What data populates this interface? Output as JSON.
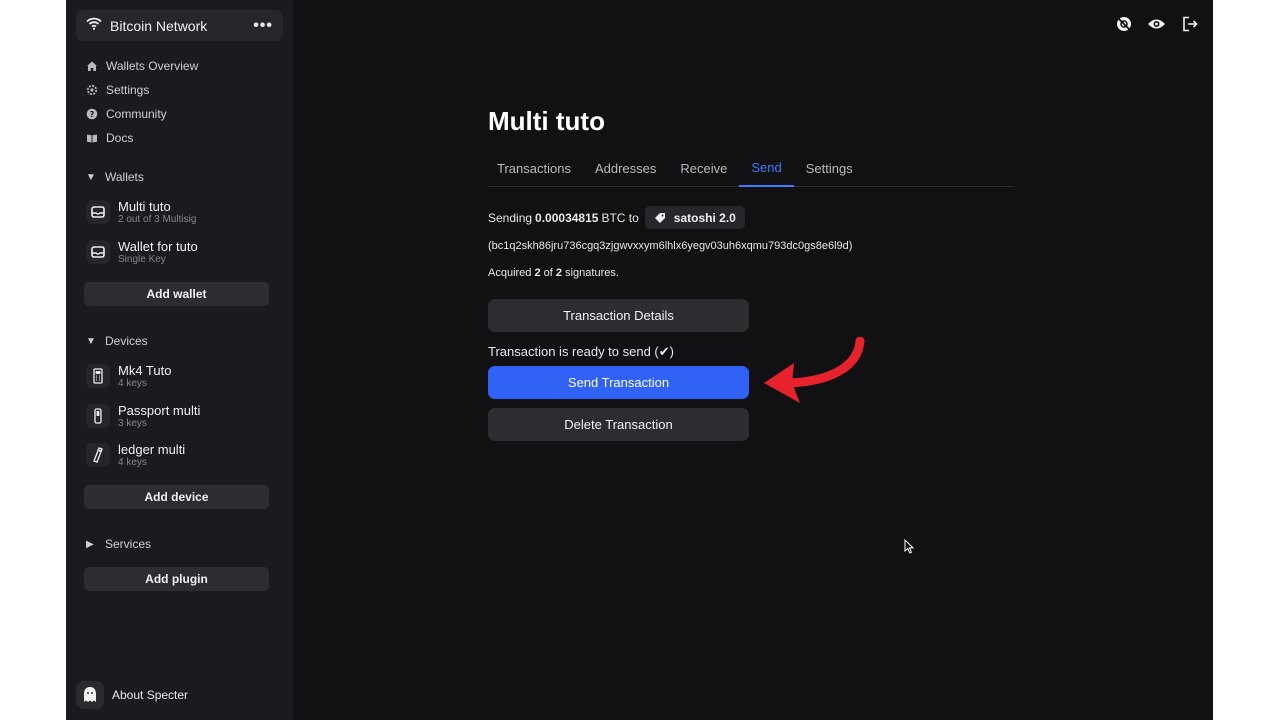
{
  "sidebar": {
    "network_label": "Bitcoin Network",
    "nav": [
      {
        "label": "Wallets Overview",
        "icon": "home-icon"
      },
      {
        "label": "Settings",
        "icon": "gear-icon"
      },
      {
        "label": "Community",
        "icon": "help-icon"
      },
      {
        "label": "Docs",
        "icon": "book-icon"
      }
    ],
    "wallets_header": "Wallets",
    "wallets": [
      {
        "name": "Multi tuto",
        "sub": "2 out of 3 Multisig"
      },
      {
        "name": "Wallet for tuto",
        "sub": "Single Key"
      }
    ],
    "add_wallet": "Add wallet",
    "devices_header": "Devices",
    "devices": [
      {
        "name": "Mk4 Tuto",
        "sub": "4 keys"
      },
      {
        "name": "Passport multi",
        "sub": "3 keys"
      },
      {
        "name": "ledger multi",
        "sub": "4 keys"
      }
    ],
    "add_device": "Add device",
    "services_header": "Services",
    "add_plugin": "Add plugin",
    "about": "About Specter"
  },
  "main": {
    "title": "Multi tuto",
    "tabs": [
      "Transactions",
      "Addresses",
      "Receive",
      "Send",
      "Settings"
    ],
    "active_tab": "Send",
    "sending_prefix": "Sending",
    "amount": "0.00034815",
    "amount_unit": "BTC to",
    "recipient_label": "satoshi 2.0",
    "address": "(bc1q2skh86jru736cgq3zjgwvxxym6lhlx6yegv03uh6xqmu793dc0gs8e6l9d)",
    "acquired_prefix": "Acquired",
    "acquired": "2",
    "of_text": "of",
    "required": "2",
    "signatures_suffix": "signatures.",
    "details_button": "Transaction Details",
    "ready_text": "Transaction is ready to send (✔)",
    "send_button": "Send Transaction",
    "delete_button": "Delete Transaction"
  },
  "colors": {
    "accent": "#2f62f5",
    "annotation_arrow": "#e8222c",
    "background": "#111114",
    "sidebar": "#1b1b1f"
  }
}
